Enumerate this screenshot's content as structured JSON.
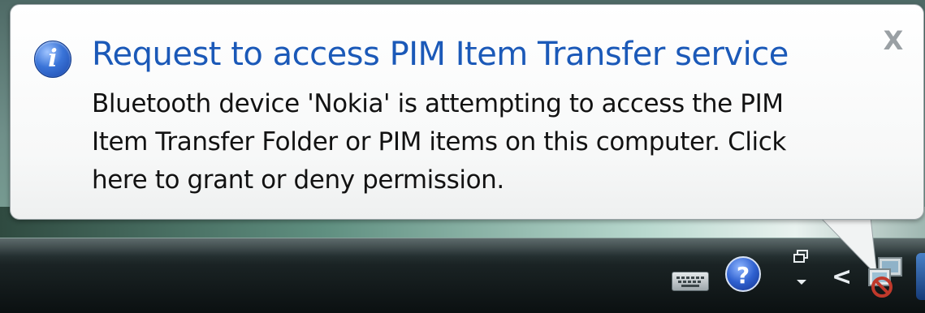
{
  "notification": {
    "title": "Request to access PIM Item Transfer service",
    "body_lines": [
      "Bluetooth device 'Nokia' is attempting to access the PIM",
      "Item Transfer Folder or PIM items on this computer.  Click",
      "here to grant or deny permission."
    ],
    "info_icon_glyph": "i",
    "close_glyph": "X",
    "icon": "info-icon",
    "close_icon": "close-icon"
  },
  "taskbar": {
    "tray_icons": [
      {
        "name": "keyboard-icon"
      },
      {
        "name": "help-icon",
        "glyph": "?"
      },
      {
        "name": "restore-window-icon"
      },
      {
        "name": "chevron-left-icon",
        "glyph": "<"
      },
      {
        "name": "network-icon"
      }
    ]
  },
  "colors": {
    "title": "#1b59b8",
    "body_text": "#121212",
    "close": "#9aa0a4",
    "balloon_bg": "#ffffff",
    "taskbar_bg": "#0b1011"
  }
}
